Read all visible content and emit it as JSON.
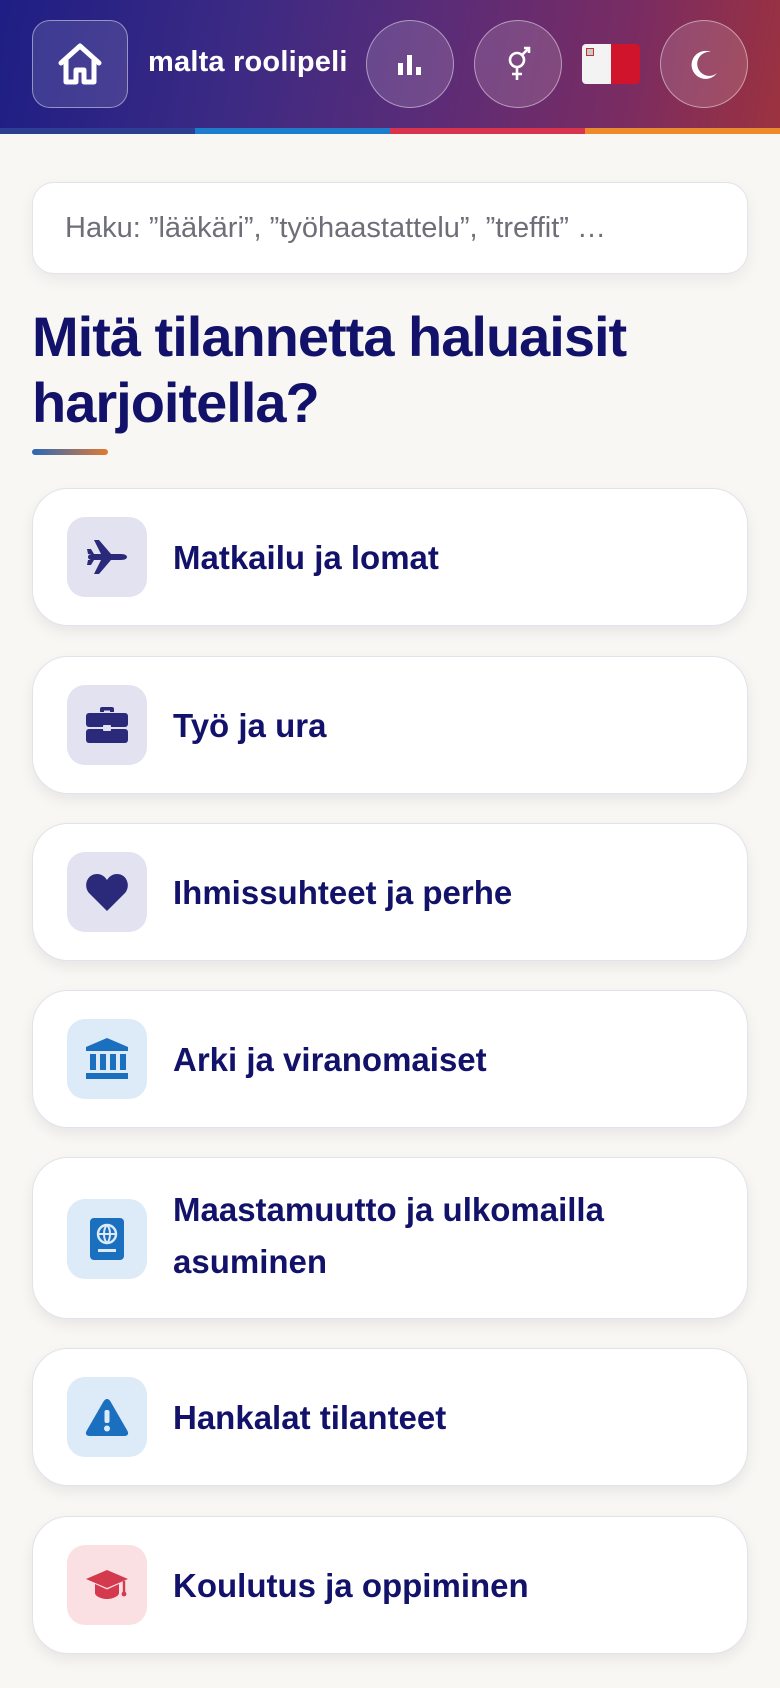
{
  "header": {
    "title": "malta roolipeli",
    "home_icon": "home-icon",
    "stats_icon": "bar-chart-icon",
    "gender_icon": "gender-icon",
    "flag_icon": "malta-flag-icon",
    "theme_icon": "moon-icon",
    "colors": {
      "gradient_start": "#1e1e84",
      "gradient_end": "#9c323f",
      "stripe": [
        "#2d3f90",
        "#1d7ccc",
        "#d8344f",
        "#ec8a2c"
      ]
    }
  },
  "search": {
    "placeholder": "Haku: ”lääkäri”, ”työhaastattelu”, ”treffit” …"
  },
  "heading": "Mitä tilannetta haluaisit harjoitella?",
  "categories": [
    {
      "label": "Matkailu ja lomat",
      "icon": "airplane-icon",
      "tile_color": "#e3e2f0",
      "icon_color": "#2b2a7a"
    },
    {
      "label": "Työ ja ura",
      "icon": "briefcase-icon",
      "tile_color": "#e3e2f0",
      "icon_color": "#2b2a7a"
    },
    {
      "label": "Ihmissuhteet ja perhe",
      "icon": "heart-icon",
      "tile_color": "#e3e2f0",
      "icon_color": "#2b2a7a"
    },
    {
      "label": "Arki ja viranomaiset",
      "icon": "government-building-icon",
      "tile_color": "#ddeaf7",
      "icon_color": "#1b6fbf"
    },
    {
      "label": "Maastamuutto ja ulkomailla asuminen",
      "icon": "passport-icon",
      "tile_color": "#ddeaf7",
      "icon_color": "#1b6fbf"
    },
    {
      "label": "Hankalat tilanteet",
      "icon": "warning-icon",
      "tile_color": "#ddeaf7",
      "icon_color": "#1b6fbf"
    },
    {
      "label": "Koulutus ja oppiminen",
      "icon": "graduation-cap-icon",
      "tile_color": "#fbe0e3",
      "icon_color": "#d33a4e"
    }
  ]
}
